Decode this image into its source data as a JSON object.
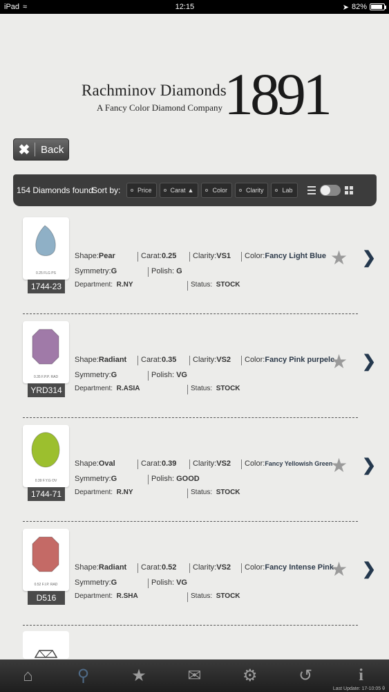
{
  "statusbar": {
    "device": "iPad",
    "time": "12:15",
    "battery": "82%",
    "battery_level": 0.82
  },
  "brand": {
    "name": "Rachminov Diamonds",
    "tagline": "A Fancy Color Diamond Company",
    "year": "1891"
  },
  "back": {
    "label": "Back"
  },
  "toolbar": {
    "count": "154 Diamonds found",
    "sort_label": "Sort by:",
    "sort_options": [
      "Price",
      "Carat",
      "Color",
      "Clarity",
      "Lab"
    ],
    "active_sort": "Carat"
  },
  "labels": {
    "shape": "Shape:",
    "carat": "Carat:",
    "clarity": "Clarity:",
    "color": "Color:",
    "symmetry": "Symmetry:",
    "polish": "Polish:",
    "department": "Department:",
    "status": "Status:"
  },
  "items": [
    {
      "code": "1744-23",
      "tiny": "0.25 FLG PS",
      "shape": "Pear",
      "carat": "0.25",
      "clarity": "VS1",
      "color": "Fancy Light Blue",
      "symmetry": "G",
      "polish": "G",
      "department": "R.NY",
      "status": "STOCK",
      "gem_color": "#8fb0c6"
    },
    {
      "code": "YRD314",
      "tiny": "0.35 F.P.P. RAD",
      "shape": "Radiant",
      "carat": "0.35",
      "clarity": "VS2",
      "color": "Fancy Pink purpele",
      "symmetry": "G",
      "polish": "VG",
      "department": "R.ASIA",
      "status": "STOCK",
      "gem_color": "#a07aa8"
    },
    {
      "code": "1744-71",
      "tiny": "0.39 F.Y.G OV",
      "shape": "Oval",
      "carat": "0.39",
      "clarity": "VS2",
      "color": "Fancy Yellowish Green",
      "symmetry": "G",
      "polish": "GOOD",
      "department": "R.NY",
      "status": "STOCK",
      "gem_color": "#9cbf2e"
    },
    {
      "code": "D516",
      "tiny": "0.52 F.I.P. RAD",
      "shape": "Radiant",
      "carat": "0.52",
      "clarity": "VS2",
      "color": "Fancy Intense Pink",
      "symmetry": "G",
      "polish": "VG",
      "department": "R.SHA",
      "status": "STOCK",
      "gem_color": "#c46a66"
    }
  ],
  "tabbar": {
    "tabs": [
      "home",
      "search",
      "favorites",
      "mail",
      "settings",
      "sync",
      "info"
    ],
    "last_update": "Last Update: 17-10:05 θ"
  }
}
